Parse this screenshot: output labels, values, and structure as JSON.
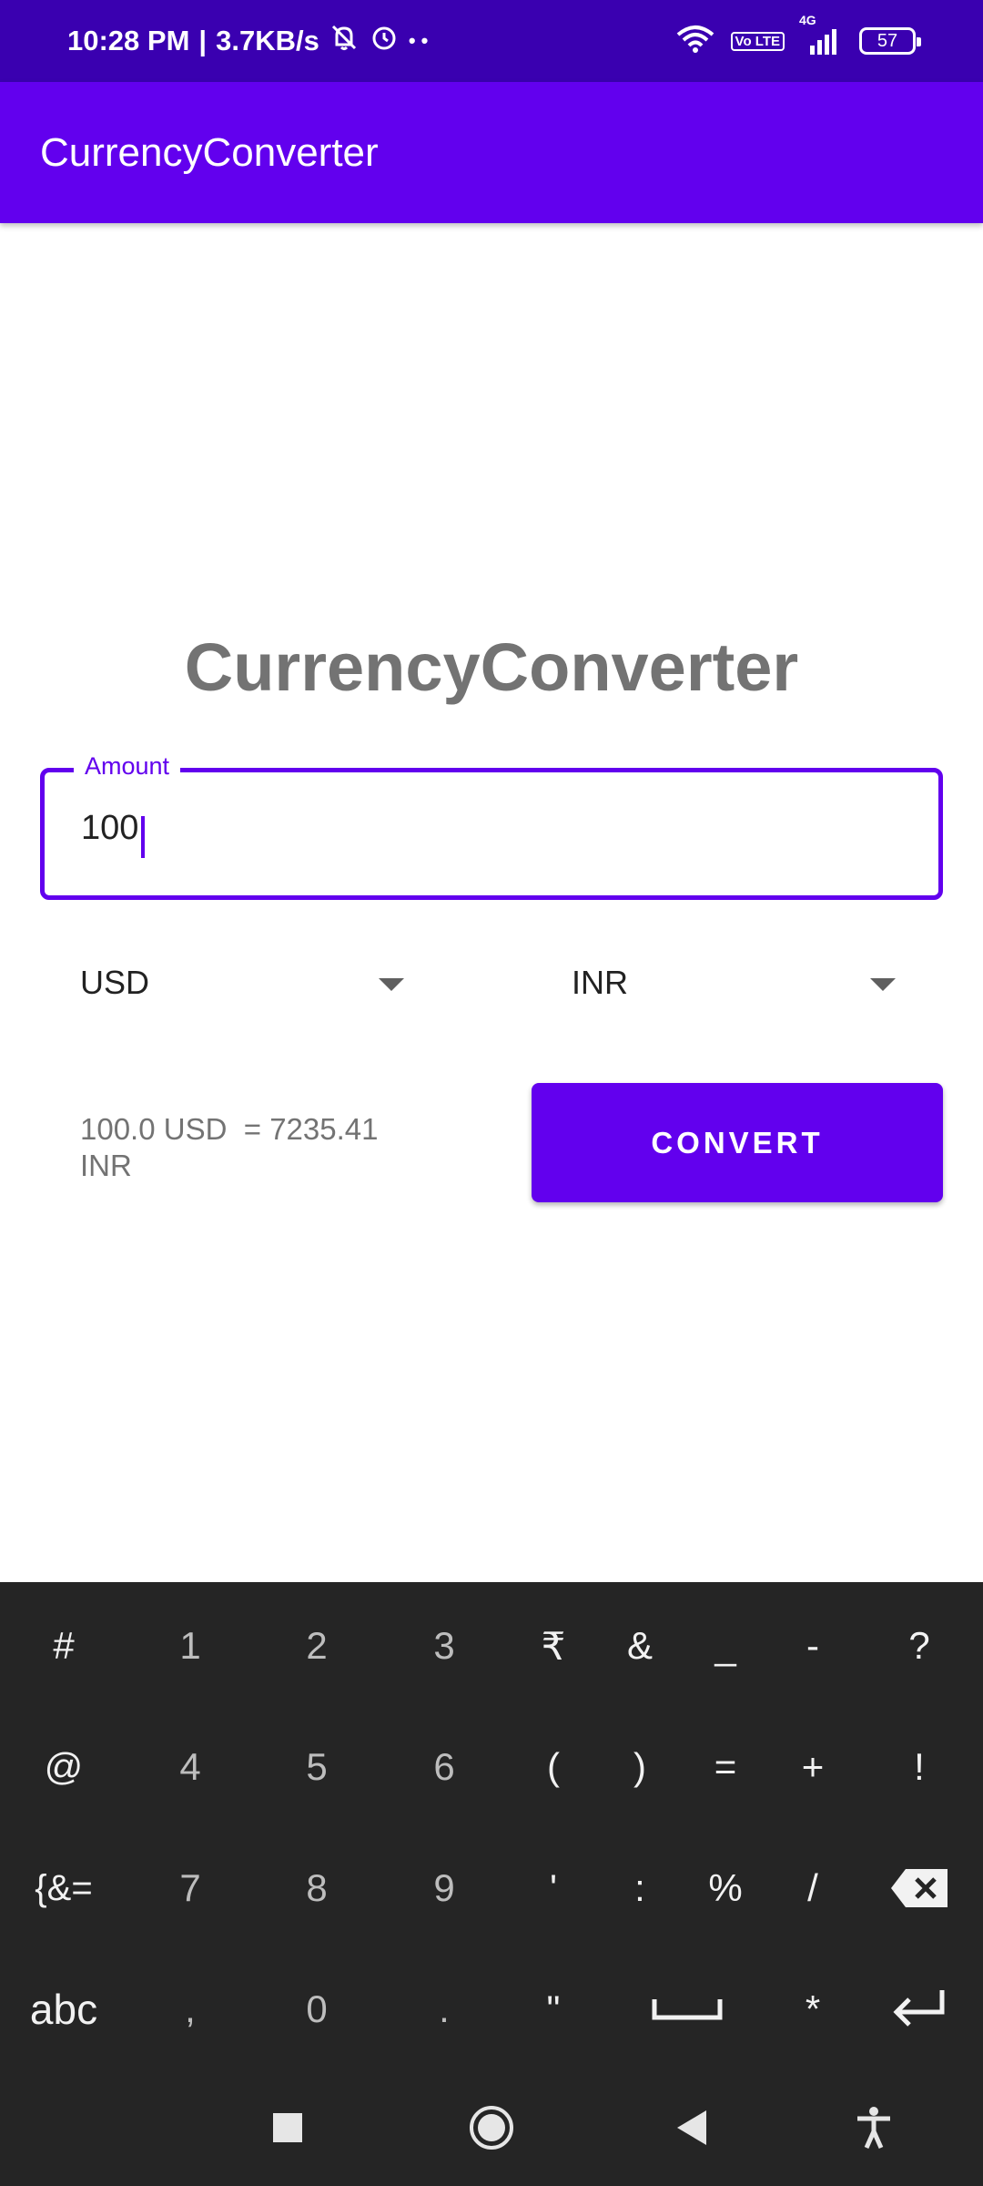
{
  "status_bar": {
    "time": "10:28 PM",
    "separator": "|",
    "speed": "3.7KB/s",
    "dots": "• •",
    "volte_label": "Vo LTE",
    "network_label": "4G",
    "battery": "57"
  },
  "app_bar": {
    "title": "CurrencyConverter"
  },
  "main": {
    "headline": "CurrencyConverter",
    "amount": {
      "label": "Amount",
      "value": "100"
    },
    "from_currency": "USD",
    "to_currency": "INR",
    "result": "100.0 USD  = 7235.41\nINR",
    "convert_label": "CONVERT"
  },
  "keyboard": {
    "rows": [
      [
        "#",
        "1",
        "2",
        "3",
        "₹",
        "&",
        "_",
        "-",
        "?"
      ],
      [
        "@",
        "4",
        "5",
        "6",
        "(",
        ")",
        "=",
        "+",
        "!"
      ],
      [
        "{&=",
        "7",
        "8",
        "9",
        "'",
        ":",
        "%",
        "/",
        "backspace-icon"
      ],
      [
        "abc",
        ",",
        "0",
        ".",
        "\"",
        "space-icon",
        "*",
        "enter-icon"
      ]
    ]
  },
  "navigation": {
    "icons": [
      "recents-square-icon",
      "home-circle-icon",
      "back-triangle-icon",
      "accessibility-icon"
    ]
  },
  "colors": {
    "status_bar": "#3a00b0",
    "primary": "#6200ee",
    "keyboard_bg": "#252525",
    "text_gray": "#737373"
  }
}
